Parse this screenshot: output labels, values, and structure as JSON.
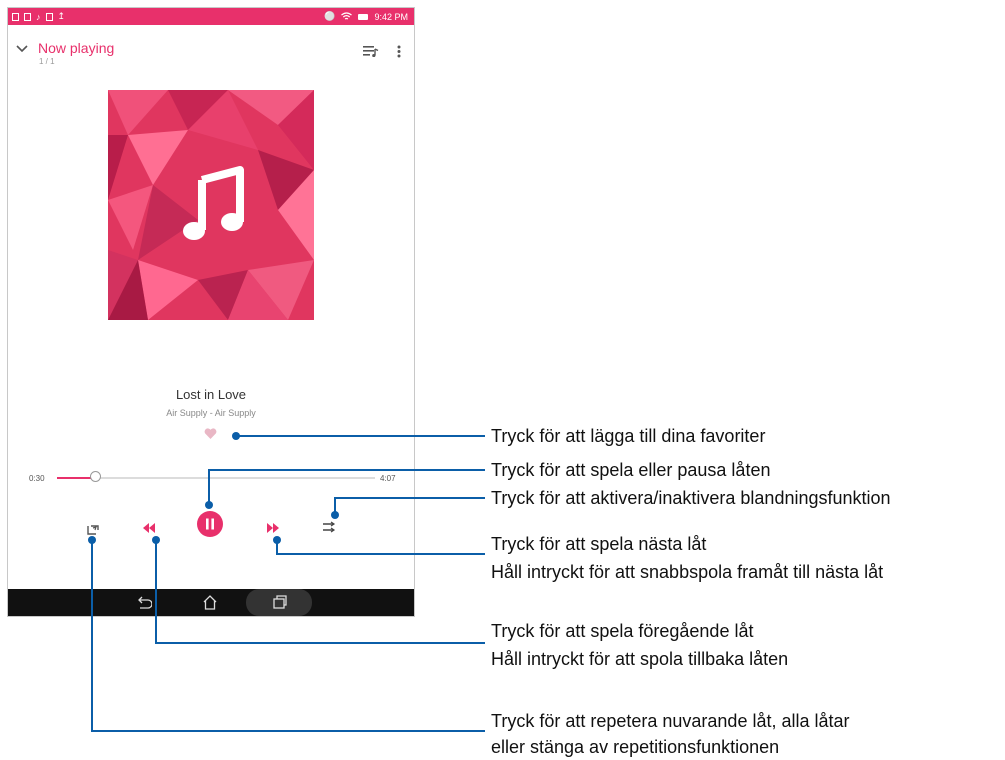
{
  "status_bar": {
    "time": "9:42 PM",
    "left_icons": [
      "notification-icon",
      "calendar-icon",
      "music-note-icon",
      "message-icon",
      "download-icon"
    ],
    "right_icons": [
      "mute-icon",
      "wifi-icon",
      "battery-icon"
    ]
  },
  "header": {
    "title": "Now playing",
    "count": "1 / 1"
  },
  "song": {
    "title": "Lost in Love",
    "artist": "Air Supply - Air Supply"
  },
  "progress": {
    "elapsed": "0:30",
    "duration": "4:07",
    "fraction": 0.12
  },
  "colors": {
    "accent": "#e8306b",
    "annotation": "#0b5ea8",
    "heart_idle": "#e9b7c5",
    "navbar": "#111111"
  },
  "annotations": {
    "favorite": "Tryck för att lägga till dina favoriter",
    "play_pause": "Tryck för att spela eller pausa låten",
    "shuffle": "Tryck för att aktivera/inaktivera blandningsfunktion",
    "next_line1": "Tryck för att spela nästa låt",
    "next_line2": "Håll intryckt för att snabbspola framåt till nästa låt",
    "prev_line1": "Tryck för att spela föregående låt",
    "prev_line2": "Håll intryckt för att spola tillbaka låten",
    "repeat_line1": "Tryck för att repetera nuvarande låt, alla låtar",
    "repeat_line2": "eller stänga av repetitionsfunktionen"
  }
}
